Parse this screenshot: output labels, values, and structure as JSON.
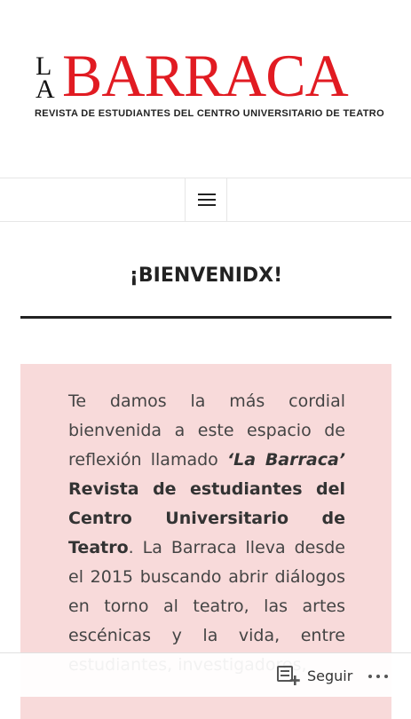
{
  "header": {
    "logo_la_l": "L",
    "logo_la_a": "A",
    "logo_barraca": "BARRACA",
    "logo_subtitle": "REVISTA DE ESTUDIANTES DEL CENTRO UNIVERSITARIO DE TEATRO",
    "logo_color": "#e11b22"
  },
  "nav": {
    "menu_icon": "hamburger-menu-icon"
  },
  "page": {
    "title": "¡BIENVENIDX!",
    "welcome_box_color": "#f8dada",
    "intro": "Te damos la más cordial bienvenida a este espacio de reflexión llamado ",
    "magazine_name": "‘La Barraca’",
    "magazine_full_name": "Revista de estudiantes del Centro Universitario de Teatro",
    "period": ".",
    "body": "La Barraca lleva desde el 2015 buscando abrir diálogos en torno al teatro, las artes escénicas y la vida, entre estudiantes, investigadores,"
  },
  "follow_bar": {
    "follow_icon": "reader-follow-icon",
    "follow_label": "Seguir",
    "more_icon": "more-options-icon"
  }
}
